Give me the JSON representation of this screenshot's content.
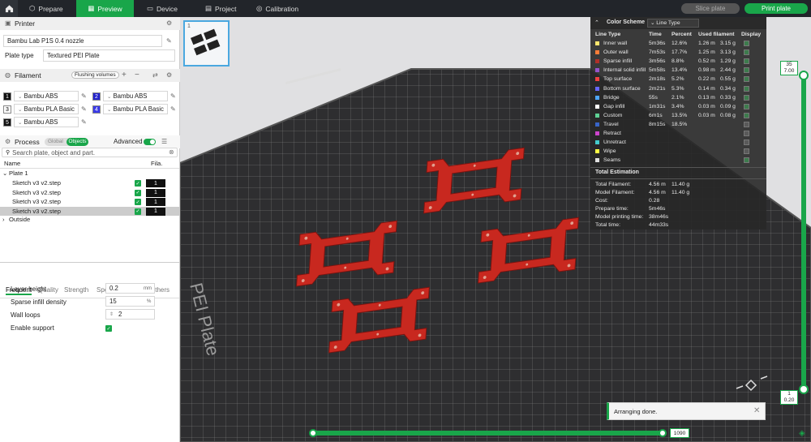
{
  "tabs": {
    "home": "",
    "prepare": "Prepare",
    "preview": "Preview",
    "device": "Device",
    "project": "Project",
    "calibration": "Calibration"
  },
  "actions": {
    "slice": "Slice plate",
    "print": "Print plate"
  },
  "printer": {
    "title": "Printer",
    "model": "Bambu Lab P1S 0.4 nozzle",
    "plate_label": "Plate type",
    "plate_value": "Textured PEI Plate"
  },
  "filament": {
    "title": "Filament",
    "flushing": "Flushing volumes",
    "items": [
      {
        "num": "1",
        "name": "Bambu ABS",
        "color": "#111111"
      },
      {
        "num": "2",
        "name": "Bambu ABS",
        "color": "#2222cc"
      },
      {
        "num": "3",
        "name": "Bambu PLA Basic",
        "color": "#ffffff"
      },
      {
        "num": "4",
        "name": "Bambu PLA Basic",
        "color": "#3a3ae8"
      },
      {
        "num": "5",
        "name": "Bambu ABS",
        "color": "#111111"
      }
    ]
  },
  "process": {
    "title": "Process",
    "global": "Global",
    "objects": "Objects",
    "advanced": "Advanced",
    "search_placeholder": "Search plate, object and part.",
    "col_name": "Name",
    "col_fila": "Fila.",
    "plate": "Plate 1",
    "objects_list": [
      {
        "name": "Sketch v3 v2.step",
        "fila": "1"
      },
      {
        "name": "Sketch v3 v2.step",
        "fila": "1"
      },
      {
        "name": "Sketch v3 v2.step",
        "fila": "1"
      },
      {
        "name": "Sketch v3 v2.step",
        "fila": "1"
      }
    ],
    "outside": "Outside"
  },
  "param_tabs": [
    "Frequent",
    "Quality",
    "Strength",
    "Speed",
    "Support",
    "Others"
  ],
  "params": {
    "layer_height_label": "Layer height",
    "layer_height": "0.2",
    "layer_height_unit": "mm",
    "infill_label": "Sparse infill density",
    "infill": "15",
    "infill_unit": "%",
    "walls_label": "Wall loops",
    "walls": "2",
    "support_label": "Enable support"
  },
  "plate_thumb_num": "1",
  "viewport": {
    "plate_text": "PEI Plate"
  },
  "legend": {
    "scheme_label": "Color Scheme",
    "scheme_value": "Line Type",
    "headers": [
      "Line Type",
      "Time",
      "Percent",
      "Used filament",
      "Display"
    ],
    "rows": [
      {
        "name": "Inner wall",
        "color": "#ffe66e",
        "time": "5m36s",
        "pct": "12.6%",
        "len": "1.26 m",
        "g": "3.15 g",
        "on": true
      },
      {
        "name": "Outer wall",
        "color": "#ff7d38",
        "time": "7m53s",
        "pct": "17.7%",
        "len": "1.25 m",
        "g": "3.13 g",
        "on": true
      },
      {
        "name": "Sparse infill",
        "color": "#b03029",
        "time": "3m56s",
        "pct": "8.8%",
        "len": "0.52 m",
        "g": "1.29 g",
        "on": true
      },
      {
        "name": "Internal solid infill",
        "color": "#9654cc",
        "time": "5m58s",
        "pct": "13.4%",
        "len": "0.98 m",
        "g": "2.44 g",
        "on": true
      },
      {
        "name": "Top surface",
        "color": "#f04040",
        "time": "2m18s",
        "pct": "5.2%",
        "len": "0.22 m",
        "g": "0.55 g",
        "on": true
      },
      {
        "name": "Bottom surface",
        "color": "#6666ff",
        "time": "2m21s",
        "pct": "5.3%",
        "len": "0.14 m",
        "g": "0.34 g",
        "on": true
      },
      {
        "name": "Bridge",
        "color": "#4da6ff",
        "time": "55s",
        "pct": "2.1%",
        "len": "0.13 m",
        "g": "0.33 g",
        "on": true
      },
      {
        "name": "Gap infill",
        "color": "#ffffff",
        "time": "1m31s",
        "pct": "3.4%",
        "len": "0.03 m",
        "g": "0.09 g",
        "on": true
      },
      {
        "name": "Custom",
        "color": "#5ed194",
        "time": "6m1s",
        "pct": "13.5%",
        "len": "0.03 m",
        "g": "0.08 g",
        "on": true
      },
      {
        "name": "Travel",
        "color": "#3865c8",
        "time": "8m15s",
        "pct": "18.5%",
        "len": "",
        "g": "",
        "on": false
      },
      {
        "name": "Retract",
        "color": "#cc44cc",
        "time": "",
        "pct": "",
        "len": "",
        "g": "",
        "on": false
      },
      {
        "name": "Unretract",
        "color": "#44cccc",
        "time": "",
        "pct": "",
        "len": "",
        "g": "",
        "on": false
      },
      {
        "name": "Wipe",
        "color": "#ffff44",
        "time": "",
        "pct": "",
        "len": "",
        "g": "",
        "on": false
      },
      {
        "name": "Seams",
        "color": "#e0e0e0",
        "time": "",
        "pct": "",
        "len": "",
        "g": "",
        "on": true
      }
    ],
    "total_title": "Total Estimation",
    "totals": [
      {
        "label": "Total Filament:",
        "len": "4.56 m",
        "g": "11.40 g"
      },
      {
        "label": "Model Filament:",
        "len": "4.56 m",
        "g": "11.40 g"
      },
      {
        "label": "Cost:",
        "len": "0.28",
        "g": ""
      },
      {
        "label": "Prepare time:",
        "len": "5m46s",
        "g": ""
      },
      {
        "label": "Model printing time:",
        "len": "38m46s",
        "g": ""
      },
      {
        "label": "Total time:",
        "len": "44m33s",
        "g": ""
      }
    ]
  },
  "layer_slider": {
    "top_layer": "35",
    "top_height": "7.00",
    "bottom_layer": "1",
    "bottom_height": "0.20"
  },
  "move_slider": {
    "value": "1090"
  },
  "toast": {
    "text": "Arranging done."
  },
  "colors": {
    "accent": "#19a64a",
    "part": "#c8281f"
  }
}
